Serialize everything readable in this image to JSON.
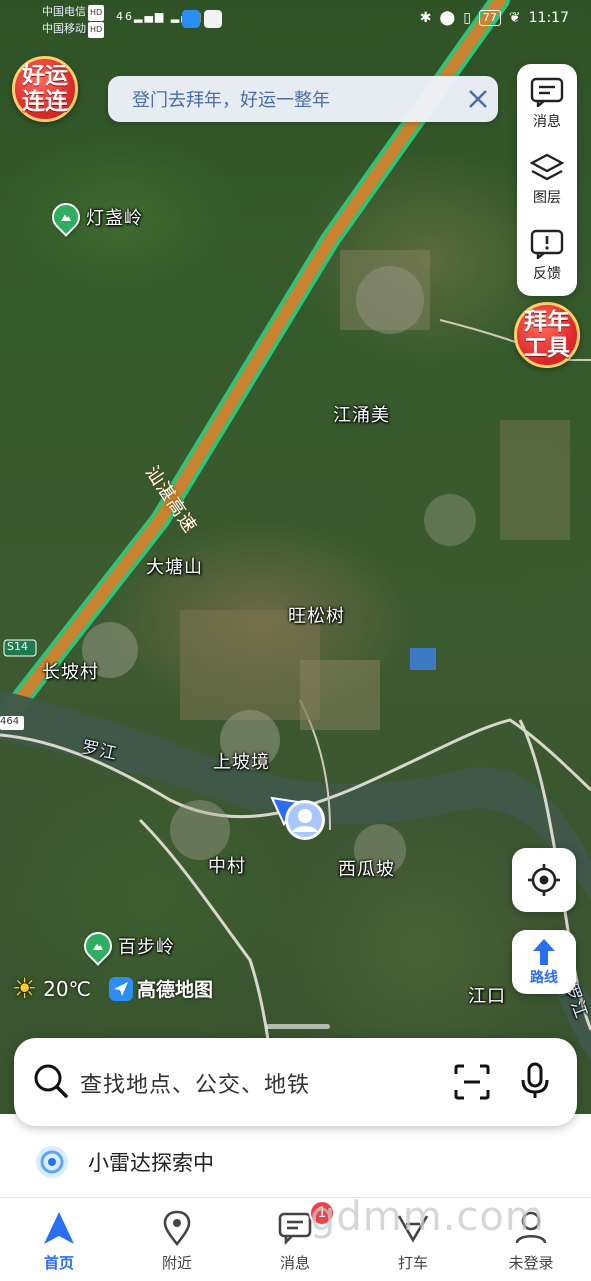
{
  "status_bar": {
    "carrier1": "中国电信",
    "carrier2": "中国移动",
    "hd": "HD",
    "signal": "46",
    "battery": "77",
    "time": "11:17"
  },
  "banner": {
    "text": "登门去拜年，好运一整年",
    "close_icon": "close-icon"
  },
  "badges": {
    "left_line1": "好运",
    "left_line2": "连连",
    "right_line1": "拜年",
    "right_line2": "工具"
  },
  "toolbar": {
    "messages_label": "消息",
    "layers_label": "图层",
    "feedback_label": "反馈"
  },
  "map_labels": {
    "highway": "汕湛高速",
    "road_s14": "S14",
    "road_464": "464",
    "river": "罗江",
    "river2": "罗江",
    "jiangyongmei": "江涌美",
    "datangshan": "大塘山",
    "wangsongshu": "旺松树",
    "changpocun": "长坡村",
    "shangpojing": "上坡境",
    "zhongcun": "中村",
    "xiguapo": "西瓜坡",
    "jiangkou": "江口",
    "poi_dengzhanling": "灯盏岭",
    "poi_baibuling": "百步岭"
  },
  "weather": {
    "temperature": "20℃",
    "brand": "高德地图"
  },
  "route_button": {
    "label": "路线"
  },
  "search": {
    "placeholder": "查找地点、公交、地铁"
  },
  "radar": {
    "text": "小雷达探索中"
  },
  "tabs": [
    {
      "label": "首页",
      "icon": "navigate-arrow-icon"
    },
    {
      "label": "附近",
      "icon": "location-pin-icon"
    },
    {
      "label": "消息",
      "icon": "message-icon"
    },
    {
      "label": "打车",
      "icon": "taxi-icon"
    },
    {
      "label": "未登录",
      "icon": "user-icon"
    }
  ],
  "notification_count": "1",
  "watermark": "gdmm.com",
  "colors": {
    "accent": "#2a6ef3",
    "highway": "#c9822f",
    "poi_green": "#2fae5f"
  }
}
